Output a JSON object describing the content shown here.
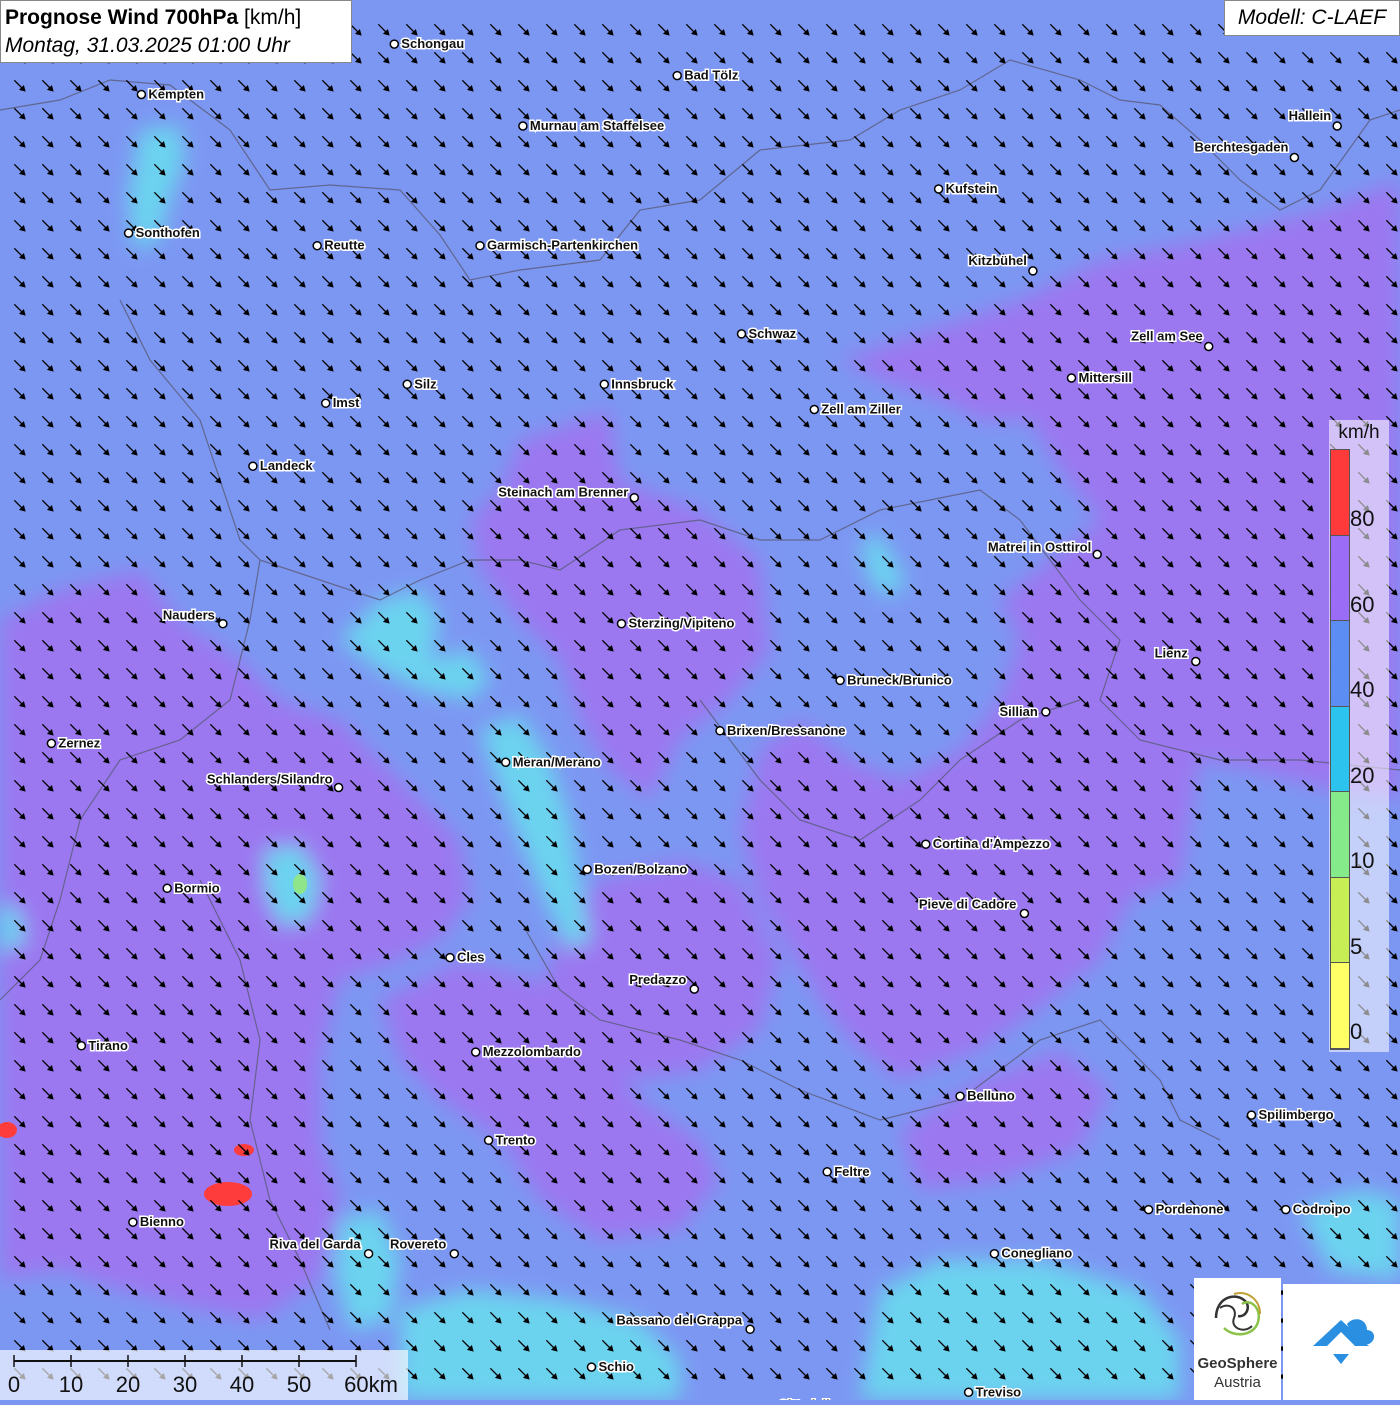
{
  "title": {
    "bold": "Prognose Wind 700hPa",
    "unit": "[km/h]",
    "subtitle": "Montag, 31.03.2025 01:00 Uhr"
  },
  "model": "Modell: C-LAEF",
  "colors": {
    "base": "#7c97f2",
    "purple": "#9b78f0",
    "cyan": "#5ed3ef",
    "green": "#8ee58a",
    "red": "#ff3c3c",
    "arrow": "#000000",
    "border": "#5a5a78"
  },
  "legend": {
    "unit": "km/h",
    "ticks": [
      "80",
      "60",
      "40",
      "20",
      "10",
      "5",
      "0"
    ],
    "segments": [
      "#ff3a3a",
      "#9b6cf6",
      "#5b8df2",
      "#2cc4ee",
      "#84ea8a",
      "#c7ef55",
      "#ffff66"
    ]
  },
  "wind": {
    "direction": "from north-west",
    "arrow_icon": "wind-arrow-icon"
  },
  "cities": [
    {
      "name": "Schongau",
      "lon": 10.9,
      "lat": 47.81
    },
    {
      "name": "Bad Tölz",
      "lon": 11.56,
      "lat": 47.76
    },
    {
      "name": "Kempten",
      "lon": 10.31,
      "lat": 47.73
    },
    {
      "name": "Hallein",
      "lon": 13.1,
      "lat": 47.68
    },
    {
      "name": "Murnau am Staffelsee",
      "lon": 11.2,
      "lat": 47.68
    },
    {
      "name": "Berchtesgaden",
      "lon": 13.0,
      "lat": 47.63
    },
    {
      "name": "Kufstein",
      "lon": 12.17,
      "lat": 47.58
    },
    {
      "name": "Sonthofen",
      "lon": 10.28,
      "lat": 47.51
    },
    {
      "name": "Reutte",
      "lon": 10.72,
      "lat": 47.49
    },
    {
      "name": "Garmisch-Partenkirchen",
      "lon": 11.1,
      "lat": 47.49
    },
    {
      "name": "Kitzbühel",
      "lon": 12.39,
      "lat": 47.45
    },
    {
      "name": "Schwaz",
      "lon": 11.71,
      "lat": 47.35
    },
    {
      "name": "Zell am See",
      "lon": 12.8,
      "lat": 47.33
    },
    {
      "name": "Mittersill",
      "lon": 12.48,
      "lat": 47.28
    },
    {
      "name": "Innsbruck",
      "lon": 11.39,
      "lat": 47.27
    },
    {
      "name": "Silz",
      "lon": 10.93,
      "lat": 47.27
    },
    {
      "name": "Imst",
      "lon": 10.74,
      "lat": 47.24
    },
    {
      "name": "Zell am Ziller",
      "lon": 11.88,
      "lat": 47.23
    },
    {
      "name": "Landeck",
      "lon": 10.57,
      "lat": 47.14
    },
    {
      "name": "Steinach am Brenner",
      "lon": 11.46,
      "lat": 47.09
    },
    {
      "name": "Matrei in Osttirol",
      "lon": 12.54,
      "lat": 47.0
    },
    {
      "name": "Nauders",
      "lon": 10.5,
      "lat": 46.89
    },
    {
      "name": "Sterzing/Vipiteno",
      "lon": 11.43,
      "lat": 46.89
    },
    {
      "name": "Lienz",
      "lon": 12.77,
      "lat": 46.83
    },
    {
      "name": "Bruneck/Brunico",
      "lon": 11.94,
      "lat": 46.8
    },
    {
      "name": "Sillian",
      "lon": 12.42,
      "lat": 46.75
    },
    {
      "name": "Zernez",
      "lon": 10.1,
      "lat": 46.7
    },
    {
      "name": "Brixen/Bressanone",
      "lon": 11.66,
      "lat": 46.72
    },
    {
      "name": "Meran/Merano",
      "lon": 11.16,
      "lat": 46.67
    },
    {
      "name": "Schlanders/Silandro",
      "lon": 10.77,
      "lat": 46.63
    },
    {
      "name": "Cortina d'Ampezzo",
      "lon": 12.14,
      "lat": 46.54
    },
    {
      "name": "Bozen/Bolzano",
      "lon": 11.35,
      "lat": 46.5
    },
    {
      "name": "Bormio",
      "lon": 10.37,
      "lat": 46.47
    },
    {
      "name": "Pieve di Cadore",
      "lon": 12.37,
      "lat": 46.43
    },
    {
      "name": "Cles",
      "lon": 11.03,
      "lat": 46.36
    },
    {
      "name": "Predazzo",
      "lon": 11.6,
      "lat": 46.31
    },
    {
      "name": "Tirano",
      "lon": 10.17,
      "lat": 46.22
    },
    {
      "name": "Mezzolombardo",
      "lon": 11.09,
      "lat": 46.21
    },
    {
      "name": "Belluno",
      "lon": 12.22,
      "lat": 46.14
    },
    {
      "name": "Spilimbergo",
      "lon": 12.9,
      "lat": 46.11
    },
    {
      "name": "Trento",
      "lon": 11.12,
      "lat": 46.07
    },
    {
      "name": "Feltre",
      "lon": 11.91,
      "lat": 46.02
    },
    {
      "name": "Pordenone",
      "lon": 12.66,
      "lat": 45.96
    },
    {
      "name": "Codroipo",
      "lon": 12.98,
      "lat": 45.96
    },
    {
      "name": "Bienno",
      "lon": 10.29,
      "lat": 45.94
    },
    {
      "name": "Riva del Garda",
      "lon": 10.84,
      "lat": 45.89
    },
    {
      "name": "Rovereto",
      "lon": 11.04,
      "lat": 45.89
    },
    {
      "name": "Conegliano",
      "lon": 12.3,
      "lat": 45.89
    },
    {
      "name": "Bassano del Grappa",
      "lon": 11.73,
      "lat": 45.77
    },
    {
      "name": "Schio",
      "lon": 11.36,
      "lat": 45.71
    },
    {
      "name": "Treviso",
      "lon": 12.24,
      "lat": 45.67
    },
    {
      "name": "Cittadella",
      "lon": 11.78,
      "lat": 45.65
    }
  ],
  "scalebar": {
    "labels": [
      "0",
      "10",
      "20",
      "30",
      "40",
      "50",
      "60km"
    ]
  },
  "logos": {
    "geosphere_line1": "GeoSphere",
    "geosphere_line2": "Austria"
  }
}
